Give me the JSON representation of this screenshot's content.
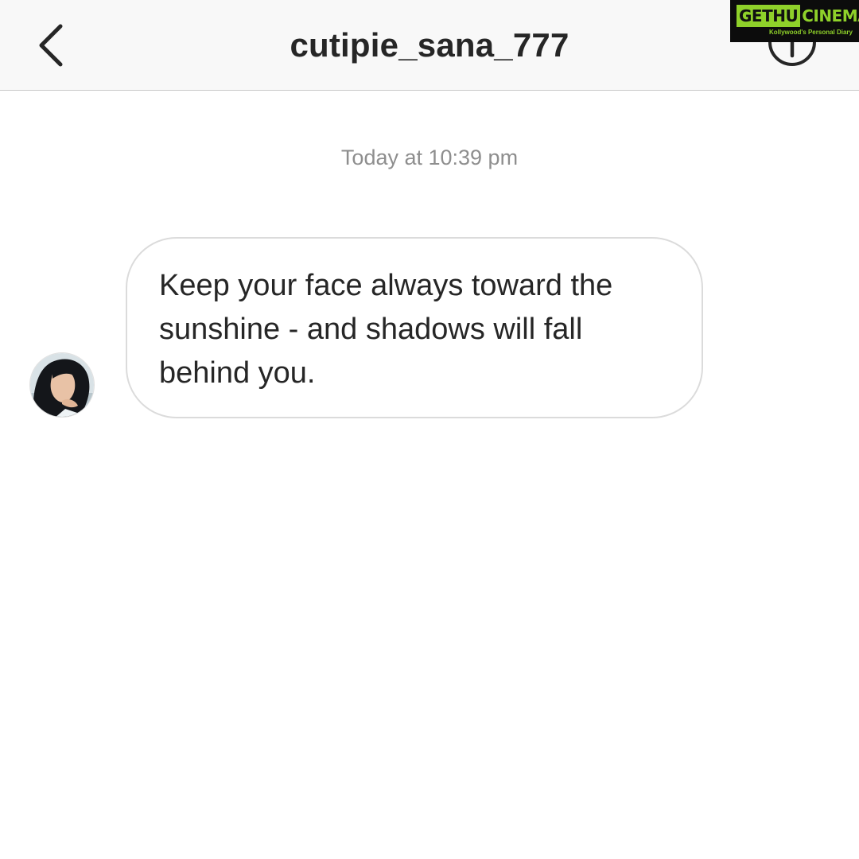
{
  "header": {
    "title": "cutipie_sana_777",
    "back_icon": "chevron-left-icon",
    "info_icon": "info-circle-icon"
  },
  "watermark": {
    "brand_part1": "GETHU",
    "brand_part2": "CINEMA",
    "tagline": "Kollywood's Personal Diary",
    "accent_color": "#8fd12a"
  },
  "conversation": {
    "timestamp": "Today at 10:39 pm",
    "messages": [
      {
        "sender_avatar": "profile-avatar",
        "text": "Keep your face always toward the sunshine - and shadows will fall behind you."
      }
    ]
  }
}
